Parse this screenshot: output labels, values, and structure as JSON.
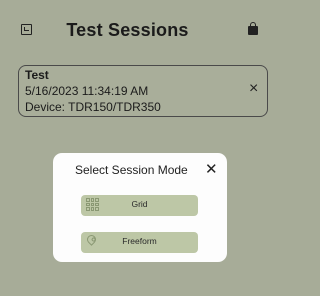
{
  "header": {
    "title": "Test Sessions",
    "left_icon": "edit-icon",
    "right_icon": "lock-icon"
  },
  "session": {
    "name": "Test",
    "timestamp": "5/16/2023 11:34:19 AM",
    "device": "Device: TDR150/TDR350",
    "close_glyph": "×"
  },
  "dialog": {
    "title": "Select Session Mode",
    "close_glyph": "✕",
    "options": [
      {
        "label": "Grid",
        "icon": "grid-icon"
      },
      {
        "label": "Freeform",
        "icon": "location-pin-icon"
      }
    ]
  },
  "colors": {
    "background": "#a7ac98",
    "dialog": "#fdfdfd",
    "button": "#bdc7a6"
  }
}
